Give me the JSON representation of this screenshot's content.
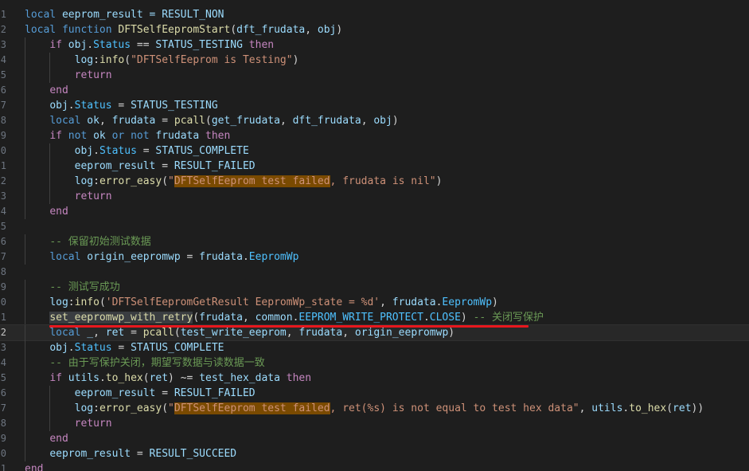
{
  "editor": {
    "active_line": "2",
    "theme_colors": {
      "background": "#1e1e1e",
      "keyword": "#569cd6",
      "function": "#dcdcaa",
      "variable": "#9cdcfe",
      "constant": "#4fc1ff",
      "string": "#ce9178",
      "comment": "#6a9955",
      "highlight": "#7a4a00",
      "annotation_underline": "#e8171d"
    },
    "line_numbers": [
      "1",
      "2",
      "3",
      "4",
      "5",
      "6",
      "7",
      "8",
      "9",
      "0",
      "1",
      "2",
      "3",
      "4",
      "5",
      "6",
      "7",
      "8",
      "9",
      "0",
      "1",
      "2",
      "3",
      "4",
      "5",
      "6",
      "7",
      "8",
      "9",
      "0",
      "1"
    ],
    "lines": [
      [
        {
          "t": "local",
          "c": "k"
        },
        {
          "t": " eeprom_result = ",
          "c": "v"
        },
        {
          "t": "RESULT_NON",
          "c": "v"
        }
      ],
      [
        {
          "t": "local",
          "c": "k"
        },
        {
          "t": " ",
          "c": "o"
        },
        {
          "t": "function",
          "c": "k"
        },
        {
          "t": " ",
          "c": "o"
        },
        {
          "t": "DFTSelfEepromStart",
          "c": "f"
        },
        {
          "t": "(",
          "c": "o"
        },
        {
          "t": "dft_frudata",
          "c": "v"
        },
        {
          "t": ", ",
          "c": "o"
        },
        {
          "t": "obj",
          "c": "v"
        },
        {
          "t": ")",
          "c": "o"
        }
      ],
      [
        {
          "t": "if",
          "c": "kc"
        },
        {
          "t": " ",
          "c": "o"
        },
        {
          "t": "obj",
          "c": "v"
        },
        {
          "t": ".",
          "c": "o"
        },
        {
          "t": "Status",
          "c": "c"
        },
        {
          "t": " == ",
          "c": "o"
        },
        {
          "t": "STATUS_TESTING",
          "c": "v"
        },
        {
          "t": " ",
          "c": "o"
        },
        {
          "t": "then",
          "c": "kc"
        }
      ],
      [
        {
          "t": "log",
          "c": "v"
        },
        {
          "t": ":",
          "c": "o"
        },
        {
          "t": "info",
          "c": "f"
        },
        {
          "t": "(",
          "c": "o"
        },
        {
          "t": "\"DFTSelfEeprom is Testing\"",
          "c": "s"
        },
        {
          "t": ")",
          "c": "o"
        }
      ],
      [
        {
          "t": "return",
          "c": "kc"
        }
      ],
      [
        {
          "t": "end",
          "c": "kc"
        }
      ],
      [
        {
          "t": "obj",
          "c": "v"
        },
        {
          "t": ".",
          "c": "o"
        },
        {
          "t": "Status",
          "c": "c"
        },
        {
          "t": " = ",
          "c": "o"
        },
        {
          "t": "STATUS_TESTING",
          "c": "v"
        }
      ],
      [
        {
          "t": "local",
          "c": "k"
        },
        {
          "t": " ",
          "c": "o"
        },
        {
          "t": "ok",
          "c": "v"
        },
        {
          "t": ", ",
          "c": "o"
        },
        {
          "t": "frudata",
          "c": "v"
        },
        {
          "t": " = ",
          "c": "o"
        },
        {
          "t": "pcall",
          "c": "f"
        },
        {
          "t": "(",
          "c": "o"
        },
        {
          "t": "get_frudata",
          "c": "v"
        },
        {
          "t": ", ",
          "c": "o"
        },
        {
          "t": "dft_frudata",
          "c": "v"
        },
        {
          "t": ", ",
          "c": "o"
        },
        {
          "t": "obj",
          "c": "v"
        },
        {
          "t": ")",
          "c": "o"
        }
      ],
      [
        {
          "t": "if",
          "c": "kc"
        },
        {
          "t": " ",
          "c": "o"
        },
        {
          "t": "not",
          "c": "k"
        },
        {
          "t": " ",
          "c": "o"
        },
        {
          "t": "ok",
          "c": "v"
        },
        {
          "t": " ",
          "c": "o"
        },
        {
          "t": "or",
          "c": "k"
        },
        {
          "t": " ",
          "c": "o"
        },
        {
          "t": "not",
          "c": "k"
        },
        {
          "t": " ",
          "c": "o"
        },
        {
          "t": "frudata",
          "c": "v"
        },
        {
          "t": " ",
          "c": "o"
        },
        {
          "t": "then",
          "c": "kc"
        }
      ],
      [
        {
          "t": "obj",
          "c": "v"
        },
        {
          "t": ".",
          "c": "o"
        },
        {
          "t": "Status",
          "c": "c"
        },
        {
          "t": " = ",
          "c": "o"
        },
        {
          "t": "STATUS_COMPLETE",
          "c": "v"
        }
      ],
      [
        {
          "t": "eeprom_result",
          "c": "v"
        },
        {
          "t": " = ",
          "c": "o"
        },
        {
          "t": "RESULT_FAILED",
          "c": "v"
        }
      ],
      [
        {
          "t": "log",
          "c": "v"
        },
        {
          "t": ":",
          "c": "o"
        },
        {
          "t": "error_easy",
          "c": "f"
        },
        {
          "t": "(",
          "c": "o"
        },
        {
          "t": "\"",
          "c": "s"
        },
        {
          "t": "DFTSelfEeprom test failed",
          "c": "hl"
        },
        {
          "t": ", frudata is nil\"",
          "c": "s"
        },
        {
          "t": ")",
          "c": "o"
        }
      ],
      [
        {
          "t": "return",
          "c": "kc"
        }
      ],
      [
        {
          "t": "end",
          "c": "kc"
        }
      ],
      [],
      [
        {
          "t": "-- 保留初始测试数据",
          "c": "cm"
        }
      ],
      [
        {
          "t": "local",
          "c": "k"
        },
        {
          "t": " ",
          "c": "o"
        },
        {
          "t": "origin_eepromwp",
          "c": "v"
        },
        {
          "t": " = ",
          "c": "o"
        },
        {
          "t": "frudata",
          "c": "v"
        },
        {
          "t": ".",
          "c": "o"
        },
        {
          "t": "EepromWp",
          "c": "c"
        }
      ],
      [],
      [
        {
          "t": "-- 测试写成功",
          "c": "cm"
        }
      ],
      [
        {
          "t": "log",
          "c": "v"
        },
        {
          "t": ":",
          "c": "o"
        },
        {
          "t": "info",
          "c": "f"
        },
        {
          "t": "(",
          "c": "o"
        },
        {
          "t": "'DFTSelfEepromGetResult EepromWp_state = %d'",
          "c": "s"
        },
        {
          "t": ", ",
          "c": "o"
        },
        {
          "t": "frudata",
          "c": "v"
        },
        {
          "t": ".",
          "c": "o"
        },
        {
          "t": "EepromWp",
          "c": "c"
        },
        {
          "t": ")",
          "c": "o"
        }
      ],
      [
        {
          "t": "set_eepromwp_with_retry",
          "c": "f sel"
        },
        {
          "t": "(",
          "c": "o"
        },
        {
          "t": "frudata",
          "c": "v"
        },
        {
          "t": ", ",
          "c": "o"
        },
        {
          "t": "common",
          "c": "v"
        },
        {
          "t": ".",
          "c": "o"
        },
        {
          "t": "EEPROM_WRITE_PROTECT",
          "c": "c"
        },
        {
          "t": ".",
          "c": "o"
        },
        {
          "t": "CLOSE",
          "c": "c"
        },
        {
          "t": ")",
          "c": "o"
        },
        {
          "t": " -- 关闭写保护",
          "c": "cm"
        }
      ],
      [
        {
          "t": "local",
          "c": "k"
        },
        {
          "t": " ",
          "c": "o"
        },
        {
          "t": "_",
          "c": "v"
        },
        {
          "t": ", ",
          "c": "o"
        },
        {
          "t": "ret",
          "c": "v"
        },
        {
          "t": " = ",
          "c": "o"
        },
        {
          "t": "pcall",
          "c": "f"
        },
        {
          "t": "(",
          "c": "o"
        },
        {
          "t": "test_write_eeprom",
          "c": "v"
        },
        {
          "t": ", ",
          "c": "o"
        },
        {
          "t": "frudata",
          "c": "v"
        },
        {
          "t": ", ",
          "c": "o"
        },
        {
          "t": "origin_eepromwp",
          "c": "v"
        },
        {
          "t": ")",
          "c": "o"
        }
      ],
      [
        {
          "t": "obj",
          "c": "v"
        },
        {
          "t": ".",
          "c": "o"
        },
        {
          "t": "Status",
          "c": "c"
        },
        {
          "t": " = ",
          "c": "o"
        },
        {
          "t": "STATUS_COMPLETE",
          "c": "v"
        }
      ],
      [
        {
          "t": "-- 由于写保护关闭，期望写数据与读数据一致",
          "c": "cm"
        }
      ],
      [
        {
          "t": "if",
          "c": "kc"
        },
        {
          "t": " ",
          "c": "o"
        },
        {
          "t": "utils",
          "c": "v"
        },
        {
          "t": ".",
          "c": "o"
        },
        {
          "t": "to_hex",
          "c": "f"
        },
        {
          "t": "(",
          "c": "o"
        },
        {
          "t": "ret",
          "c": "v"
        },
        {
          "t": ") ~= ",
          "c": "o"
        },
        {
          "t": "test_hex_data",
          "c": "v"
        },
        {
          "t": " ",
          "c": "o"
        },
        {
          "t": "then",
          "c": "kc"
        }
      ],
      [
        {
          "t": "eeprom_result",
          "c": "v"
        },
        {
          "t": " = ",
          "c": "o"
        },
        {
          "t": "RESULT_FAILED",
          "c": "v"
        }
      ],
      [
        {
          "t": "log",
          "c": "v"
        },
        {
          "t": ":",
          "c": "o"
        },
        {
          "t": "error_easy",
          "c": "f"
        },
        {
          "t": "(",
          "c": "o"
        },
        {
          "t": "\"",
          "c": "s"
        },
        {
          "t": "DFTSelfEeprom test failed",
          "c": "hl"
        },
        {
          "t": ", ret(%s) is not equal to test hex data\"",
          "c": "s"
        },
        {
          "t": ", ",
          "c": "o"
        },
        {
          "t": "utils",
          "c": "v"
        },
        {
          "t": ".",
          "c": "o"
        },
        {
          "t": "to_hex",
          "c": "f"
        },
        {
          "t": "(",
          "c": "o"
        },
        {
          "t": "ret",
          "c": "v"
        },
        {
          "t": "))",
          "c": "o"
        }
      ],
      [
        {
          "t": "return",
          "c": "kc"
        }
      ],
      [
        {
          "t": "end",
          "c": "kc"
        }
      ],
      [
        {
          "t": "eeprom_result",
          "c": "v"
        },
        {
          "t": " = ",
          "c": "o"
        },
        {
          "t": "RESULT_SUCCEED",
          "c": "v"
        }
      ],
      [
        {
          "t": "end",
          "c": "kc"
        }
      ]
    ]
  }
}
